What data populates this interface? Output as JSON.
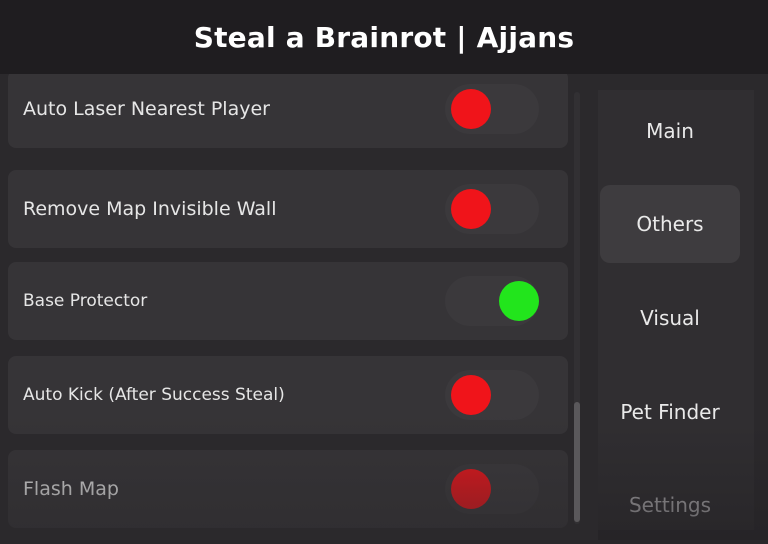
{
  "window": {
    "title": "Steal a Brainrot | Ajjans"
  },
  "features": [
    {
      "label": "Auto Laser Nearest Player",
      "state": "off"
    },
    {
      "label": "Remove Map Invisible Wall",
      "state": "off"
    },
    {
      "label": "Base Protector",
      "state": "on"
    },
    {
      "label": "Auto Kick (After Success Steal)",
      "state": "off"
    },
    {
      "label": "Flash Map",
      "state": "off"
    }
  ],
  "tabs": [
    {
      "label": "Main",
      "active": false
    },
    {
      "label": "Others",
      "active": true
    },
    {
      "label": "Visual",
      "active": false
    },
    {
      "label": "Pet Finder",
      "active": false
    },
    {
      "label": "Settings",
      "active": false
    }
  ],
  "colors": {
    "toggle_off": "#f0141a",
    "toggle_on": "#22e51c"
  }
}
